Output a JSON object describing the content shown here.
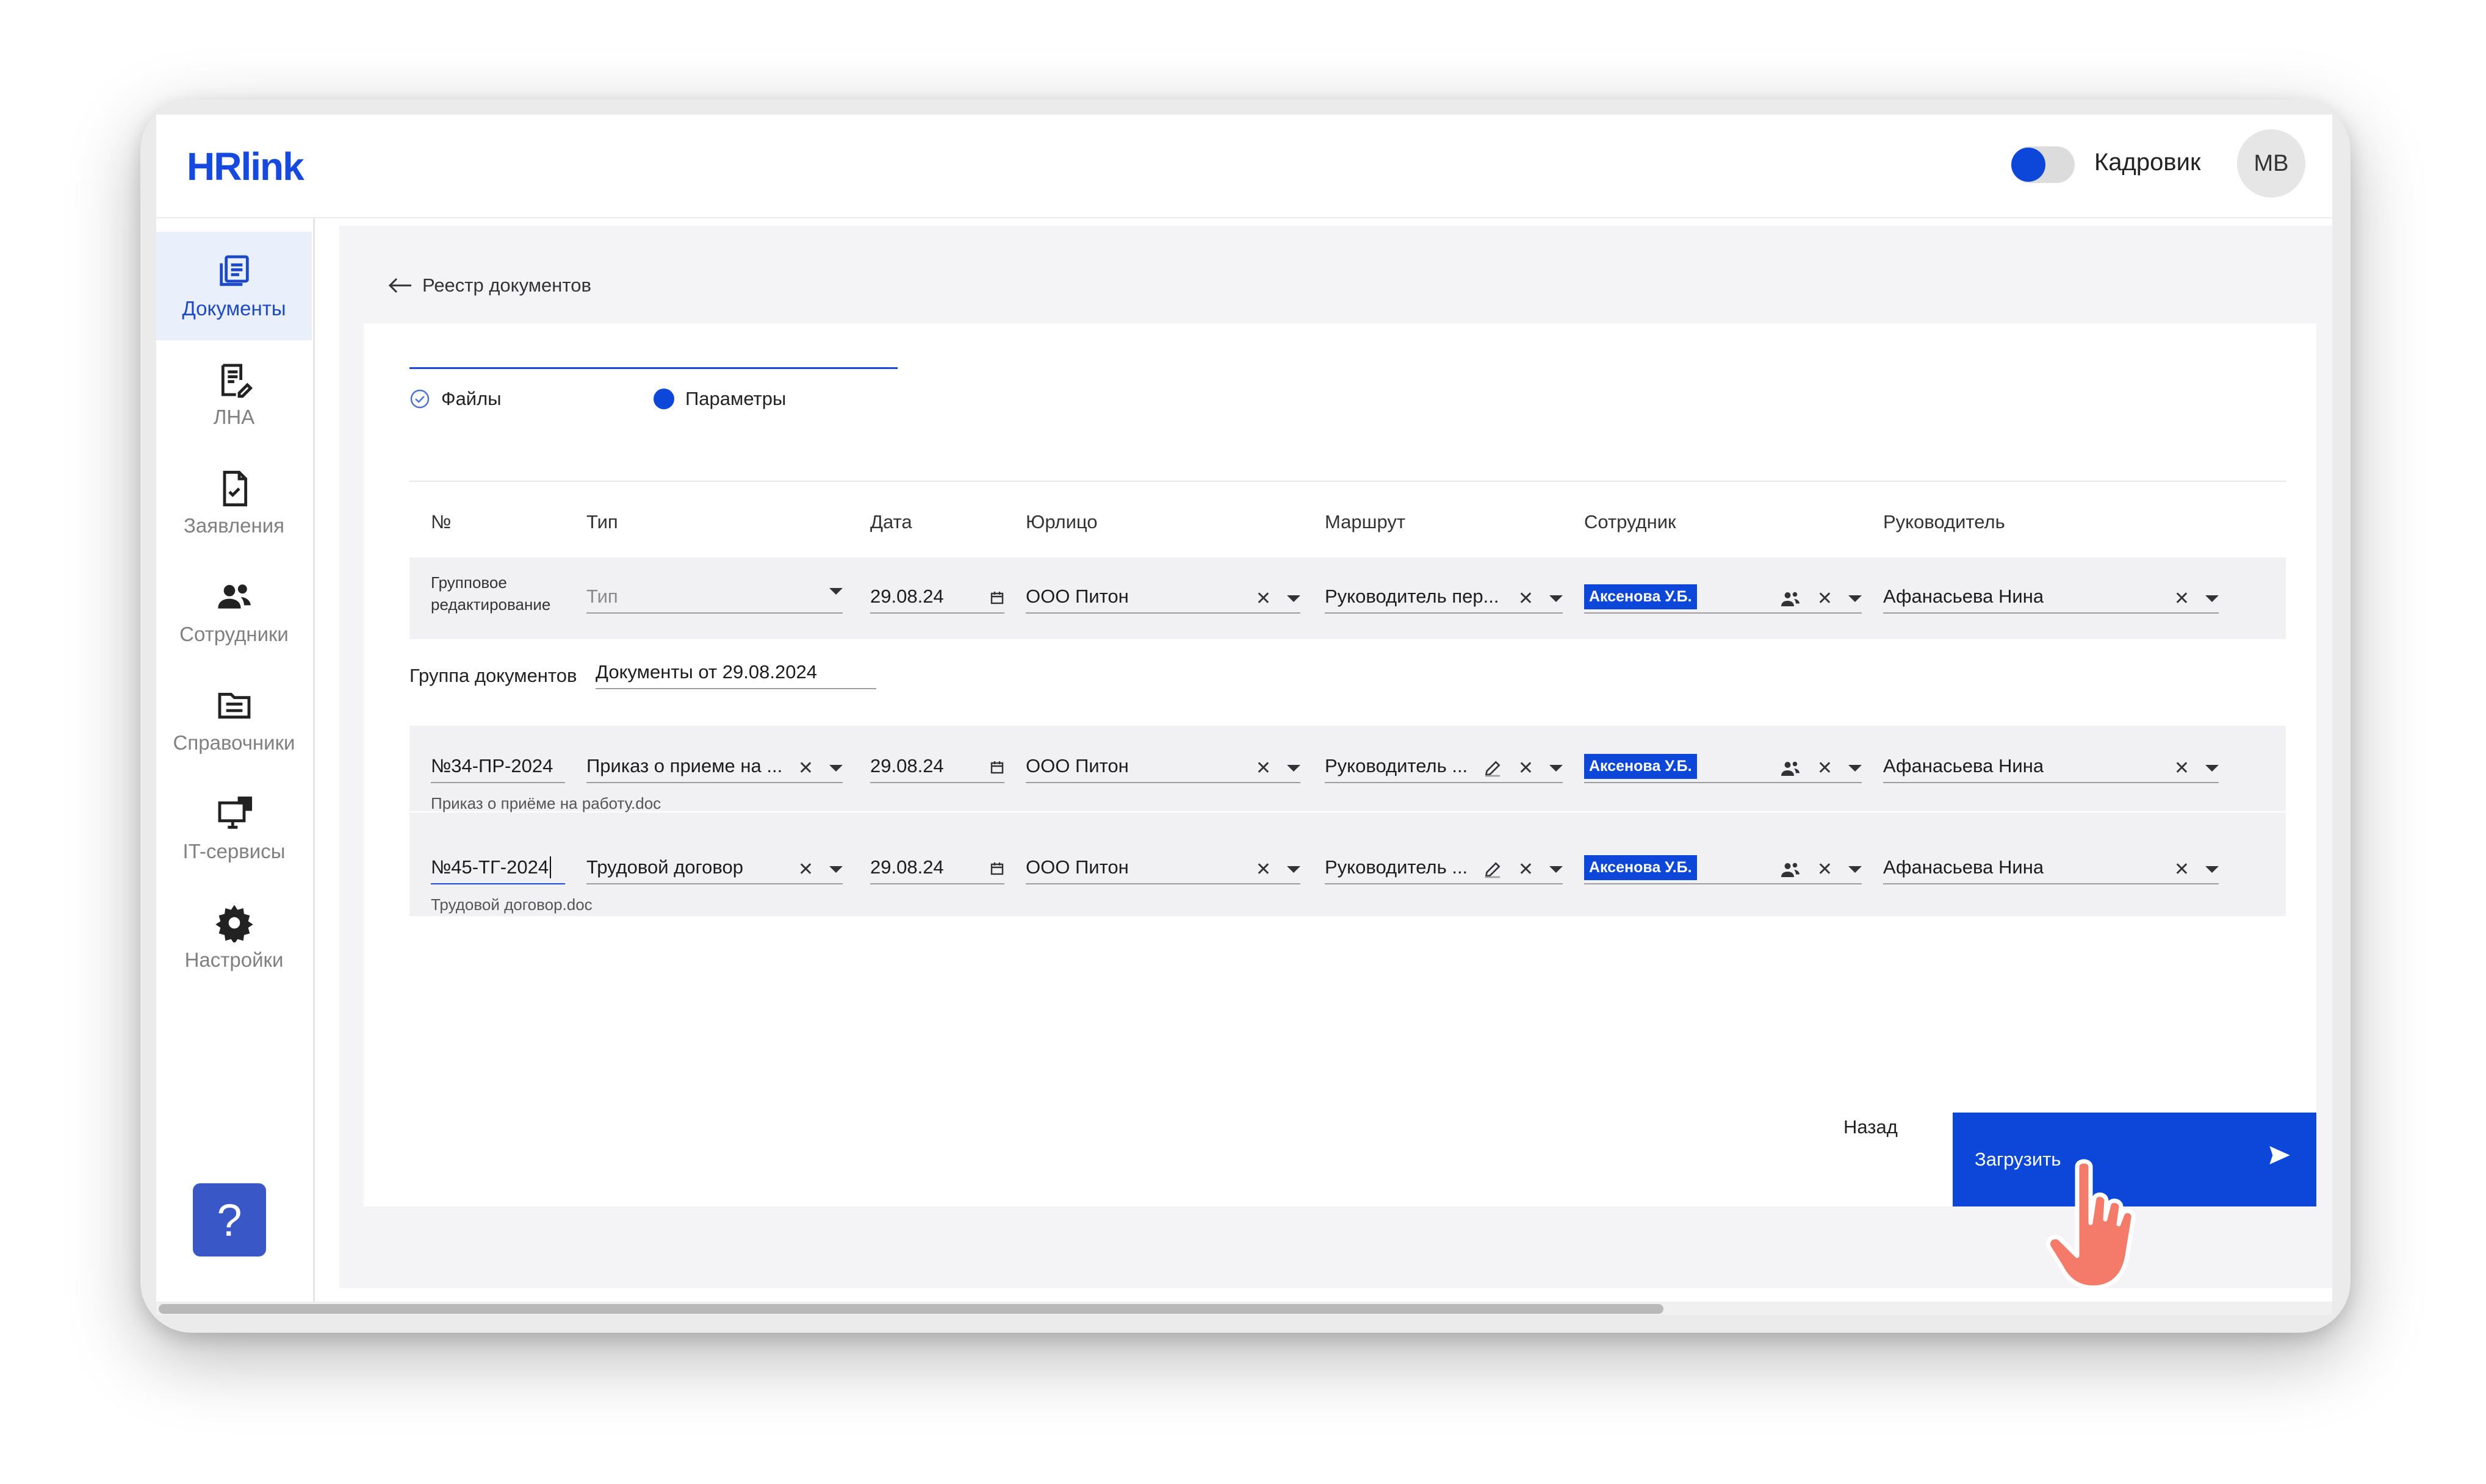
{
  "app": {
    "logo": "HRlink"
  },
  "header": {
    "role_label": "Кадровик",
    "avatar_initials": "MB"
  },
  "sidebar": {
    "items": [
      {
        "label": "Документы",
        "icon": "documents-icon",
        "active": true
      },
      {
        "label": "ЛНА",
        "icon": "lna-icon"
      },
      {
        "label": "Заявления",
        "icon": "applications-icon"
      },
      {
        "label": "Сотрудники",
        "icon": "employees-icon"
      },
      {
        "label": "Справочники",
        "icon": "directories-icon"
      },
      {
        "label": "IT-сервисы",
        "icon": "it-services-icon"
      },
      {
        "label": "Настройки",
        "icon": "settings-icon"
      }
    ],
    "help_label": "?"
  },
  "breadcrumb": {
    "back_label": "Реестр документов"
  },
  "steps": [
    {
      "label": "Файлы",
      "state": "done"
    },
    {
      "label": "Параметры",
      "state": "active"
    }
  ],
  "columns": [
    "№",
    "Тип",
    "Дата",
    "Юрлицо",
    "Маршрут",
    "Сотрудник",
    "Руководитель"
  ],
  "group_edit": {
    "label_line1": "Групповое",
    "label_line2": "редактирование",
    "type_placeholder": "Тип",
    "date": "29.08.24",
    "entity": "ООО Питон",
    "route": "Руководитель пер...",
    "employee": "Аксенова У.Б.",
    "manager": "Афанасьева Нина"
  },
  "group": {
    "label": "Группа документов",
    "value": "Документы от 29.08.2024"
  },
  "documents": [
    {
      "number": "№34-ПР-2024",
      "type": "Приказ о приеме на ...",
      "date": "29.08.24",
      "entity": "ООО Питон",
      "route": "Руководитель ...",
      "employee": "Аксенова У.Б.",
      "manager": "Афанасьева Нина",
      "file": "Приказ о приёме на работу.doc"
    },
    {
      "number": "№45-ТГ-2024",
      "type": "Трудовой договор",
      "date": "29.08.24",
      "entity": "ООО Питон",
      "route": "Руководитель ...",
      "employee": "Аксенова У.Б.",
      "manager": "Афанасьева Нина",
      "file": "Трудовой договор.doc"
    }
  ],
  "actions": {
    "back_label": "Назад",
    "upload_label": "Загрузить"
  },
  "colors": {
    "accent": "#0d47d9",
    "brand": "#1649e0",
    "upload_button": "#0d47d9",
    "hand": "#f47a6a"
  }
}
